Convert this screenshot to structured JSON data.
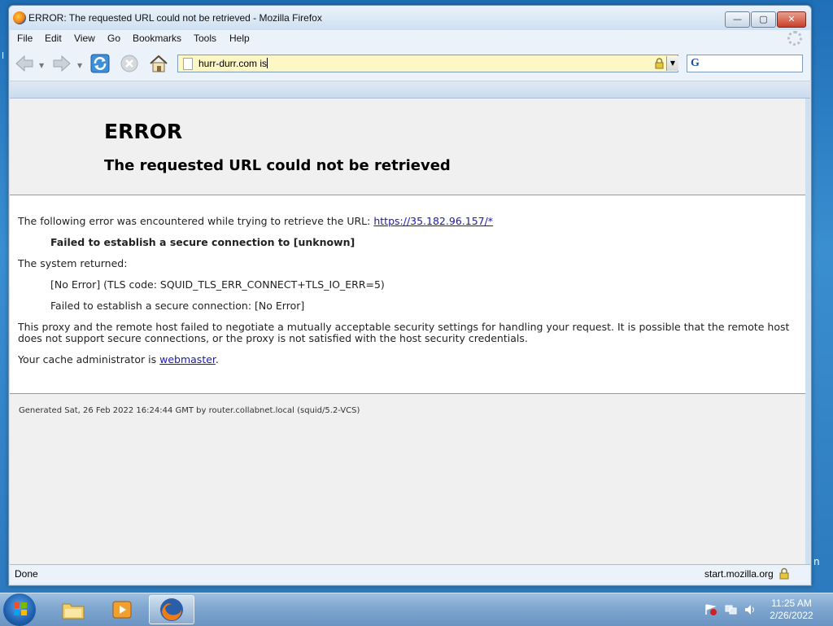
{
  "window": {
    "title": "ERROR: The requested URL could not be retrieved - Mozilla Firefox",
    "buttons": {
      "minimize": "—",
      "maximize": "▢",
      "close": "✕"
    }
  },
  "menu": {
    "items": [
      "File",
      "Edit",
      "View",
      "Go",
      "Bookmarks",
      "Tools",
      "Help"
    ]
  },
  "navbar": {
    "url": "hurr-durr.com is",
    "search_engine_letter": "G",
    "search_placeholder": ""
  },
  "page": {
    "title": "ERROR",
    "subtitle": "The requested URL could not be retrieved",
    "line1_prefix": "The following error was encountered while trying to retrieve the URL: ",
    "line1_link": "https://35.182.96.157/*",
    "error_summary": "Failed to establish a secure connection to [unknown]",
    "system_returned_label": "The system returned:",
    "system_error_1": "[No Error] (TLS code: SQUID_TLS_ERR_CONNECT+TLS_IO_ERR=5)",
    "system_error_2": "Failed to establish a secure connection: [No Error]",
    "explanation": "This proxy and the remote host failed to negotiate a mutually acceptable security settings for handling your request. It is possible that the remote host does not support secure connections, or the proxy is not satisfied with the host security credentials.",
    "admin_prefix": "Your cache administrator is ",
    "admin_link": "webmaster",
    "admin_suffix": ".",
    "generated": "Generated Sat, 26 Feb 2022 16:24:44 GMT by router.collabnet.local (squid/5.2-VCS)"
  },
  "statusbar": {
    "status": "Done",
    "host": "start.mozilla.org"
  },
  "taskbar": {
    "time": "11:25 AM",
    "date": "2/26/2022"
  },
  "desktop": {
    "edge_char": "n",
    "side_char": "l"
  },
  "colors": {
    "link": "#1a1aa6",
    "url_bar_bg": "#fcf7c4",
    "close_button": "#c7402a"
  }
}
